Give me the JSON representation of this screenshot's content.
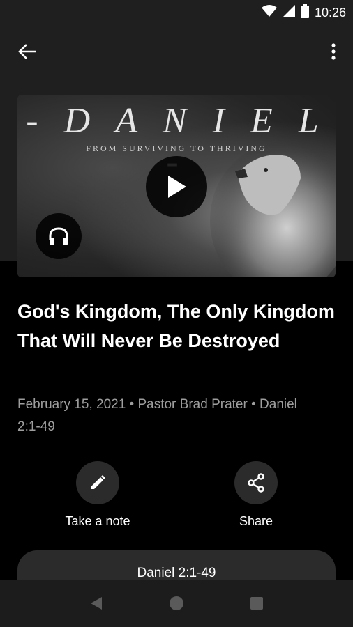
{
  "status_bar": {
    "time": "10:26"
  },
  "hero": {
    "series_title": "- D A N I E L -",
    "series_subtitle": "FROM SURVIVING TO THRIVING"
  },
  "sermon": {
    "title": "God's Kingdom, The Only Kingdom That Will Never Be Destroyed",
    "meta": "February 15, 2021 • Pastor Brad Prater • Daniel 2:1-49"
  },
  "actions": {
    "note_label": "Take a note",
    "share_label": "Share"
  },
  "scripture_button": {
    "label": "Daniel 2:1-49"
  },
  "icons": {
    "back": "arrow-back-icon",
    "more": "more-vert-icon",
    "play": "play-icon",
    "audio": "headphones-icon",
    "note": "pencil-icon",
    "share": "share-icon",
    "nav_back": "triangle-back-icon",
    "nav_home": "circle-home-icon",
    "nav_recent": "square-recents-icon"
  },
  "colors": {
    "background": "#000000",
    "header_background": "#1f1f1f",
    "button_background": "#2b2b2b",
    "meta_text": "#9e9e9e"
  }
}
